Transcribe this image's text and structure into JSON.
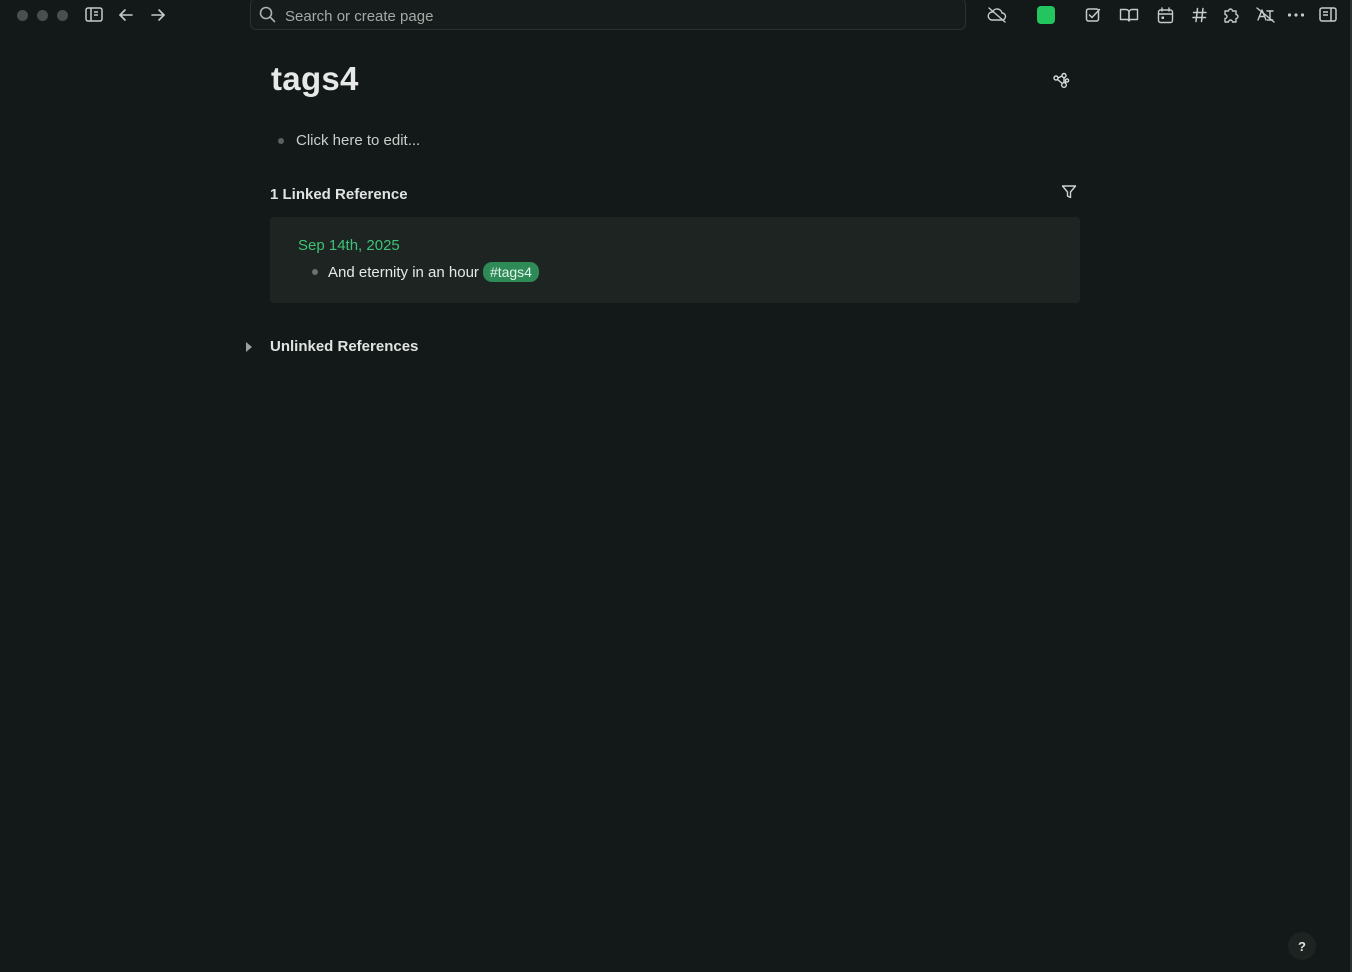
{
  "toolbar": {
    "search_placeholder": "Search or create page",
    "accent_color": "#22c55e"
  },
  "page": {
    "title": "tags4",
    "block_placeholder": "Click here to edit..."
  },
  "references": {
    "linked_heading": "1 Linked Reference",
    "items": [
      {
        "page": "Sep 14th, 2025",
        "text": "And eternity in an hour",
        "tag": "#tags4"
      }
    ],
    "unlinked_heading": "Unlinked References"
  },
  "help": {
    "label": "?"
  },
  "icons": [
    "sidebar-toggle-icon",
    "back-arrow-icon",
    "forward-arrow-icon",
    "search-icon",
    "cloud-off-icon",
    "checkbox-icon",
    "book-icon",
    "calendar-icon",
    "hash-icon",
    "puzzle-icon",
    "translate-off-icon",
    "more-icon",
    "right-sidebar-icon",
    "graph-icon",
    "filter-icon"
  ]
}
